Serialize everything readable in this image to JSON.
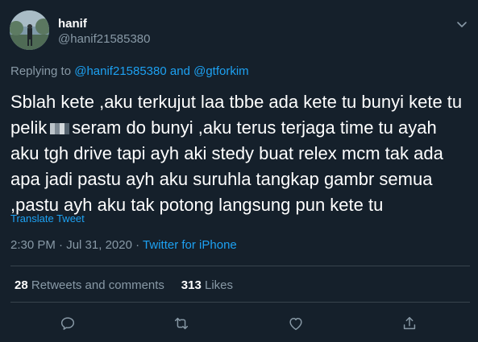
{
  "author": {
    "name": "hanif",
    "handle": "@hanif21585380"
  },
  "replying_to": {
    "prefix": "Replying to",
    "user1": "@hanif21585380",
    "conjunction": "and",
    "user2": "@gtforkim"
  },
  "tweet": {
    "text_part1": "Sblah kete ,aku terkujut laa tbbe ada kete tu bunyi kete tu\npelik",
    "text_part2": "seram do bunyi ,aku terus terjaga time tu ayah\naku tgh drive tapi ayh aki stedy buat relex mcm tak ada\napa jadi pastu ayh aku suruhla tangkap gambr semua\n,pastu ayh aku tak potong langsung pun kete tu",
    "translate_label": "Translate Tweet",
    "time": "2:30 PM",
    "date": "Jul 31, 2020",
    "separator": "·",
    "source": "Twitter for iPhone"
  },
  "stats": {
    "retweets_count": "28",
    "retweets_label": "Retweets and comments",
    "likes_count": "313",
    "likes_label": "Likes"
  },
  "icons": {
    "caret": "chevron-down-icon",
    "reply": "reply-icon",
    "retweet": "retweet-icon",
    "like": "heart-icon",
    "share": "share-icon"
  },
  "colors": {
    "background": "#15202b",
    "accent": "#1da1f2",
    "secondary_text": "#8899a6",
    "divider": "#38444d"
  }
}
